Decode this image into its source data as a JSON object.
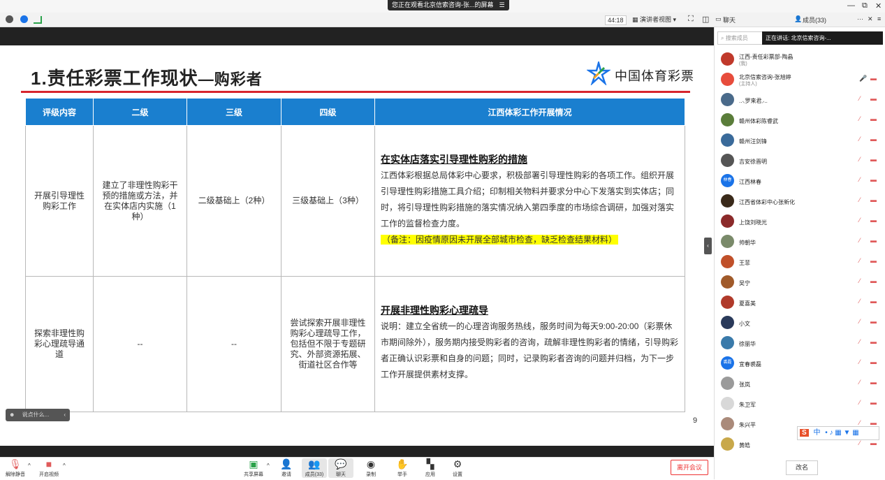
{
  "banner": {
    "text": "您正在观看北京信索咨询-张...的屏幕",
    "menu": "☰"
  },
  "window": {
    "minimize": "—",
    "restore": "⧉",
    "close": "✕"
  },
  "toolbar": {
    "timer": "44:18",
    "view_label": "演讲者视图"
  },
  "slide": {
    "title_main": "1.责任彩票工作现状",
    "title_sub": "—购彩者",
    "logo_text": "中国体育彩票",
    "headers": [
      "评级内容",
      "二级",
      "三级",
      "四级",
      "江西体彩工作开展情况"
    ],
    "rows": [
      {
        "c1": "开展引导理性购彩工作",
        "c2": "建立了非理性购彩干预的措施或方法，并在实体店内实施（1种）",
        "c3": "二级基础上（2种）",
        "c4": "三级基础上（3种）",
        "desc_title": "在实体店落实引导理性购彩的措施",
        "desc_body": "江西体彩根据总局体彩中心要求，积极部署引导理性购彩的各项工作。组织开展引导理性购彩措施工具介绍；印制相关物料并要求分中心下发落实到实体店；同时，将引导理性购彩措施的落实情况纳入第四季度的市场综合调研，加强对落实工作的监督检查力度。",
        "desc_note": "（备注：因疫情原因未开展全部城市检查，缺乏检查结果材料）"
      },
      {
        "c1": "探索非理性购彩心理疏导通道",
        "c2": "--",
        "c3": "--",
        "c4": "尝试探索开展非理性购彩心理疏导工作，包括但不限于专题研究、外部资源拓展、街道社区合作等",
        "desc_title": "开展非理性购彩心理疏导",
        "desc_body": "说明：建立全省统一的心理咨询服务热线，服务时间为每天9:00-20:00（彩票休市期间除外），服务期内接受购彩者的咨询，疏解非理性购彩者的情绪，引导购彩者正确认识彩票和自身的问题；同时，记录购彩者咨询的问题并归档，为下一步工作开展提供素材支撑。",
        "desc_note": ""
      }
    ],
    "page_number": "9"
  },
  "chat_input": {
    "placeholder": "说点什么..."
  },
  "bottom_bar": {
    "mute": "解除静音",
    "video": "开启视频",
    "share": "共享屏幕",
    "invite": "邀请",
    "members": "成员(33)",
    "chat": "聊天",
    "record": "录制",
    "raise_hand": "举手",
    "apps": "应用",
    "settings": "设置",
    "leave": "离开会议"
  },
  "panel": {
    "tab_chat": "聊天",
    "tab_members": "成员(33)",
    "search_placeholder": "搜索成员",
    "speaking": "正在讲话: 北京信索咨询-...",
    "rename": "改名",
    "members": [
      {
        "name": "江西-责任彩票部-陶晶",
        "role": "(我)",
        "color": "#c0392b"
      },
      {
        "name": "北京信索咨询-张旭婷",
        "role": "(主持人)",
        "color": "#e74c3c"
      },
      {
        "name": "..⸜罗来君⸝..",
        "role": "",
        "color": "#4a6a8a"
      },
      {
        "name": "赣州体彩陈睿武",
        "role": "",
        "color": "#5a7d3a"
      },
      {
        "name": "赣州汪剑锋",
        "role": "",
        "color": "#3a6a9a"
      },
      {
        "name": "吉安徐晋明",
        "role": "",
        "color": "#555555"
      },
      {
        "name": "江西林春",
        "role": "",
        "color": "#1a73e8"
      },
      {
        "name": "江西省体彩中心张新化",
        "role": "",
        "color": "#3a2a1a"
      },
      {
        "name": "上饶刘晓光",
        "role": "",
        "color": "#8b2a2a"
      },
      {
        "name": "帅朝华",
        "role": "",
        "color": "#7a8a6a"
      },
      {
        "name": "王菲",
        "role": "",
        "color": "#c0502a"
      },
      {
        "name": "吴宁",
        "role": "",
        "color": "#a05a2a"
      },
      {
        "name": "夏喜美",
        "role": "",
        "color": "#b03a2a"
      },
      {
        "name": "小文",
        "role": "",
        "color": "#2a3a5a"
      },
      {
        "name": "徐丽华",
        "role": "",
        "color": "#3a7aaa"
      },
      {
        "name": "宜春裘磊",
        "role": "",
        "color": "#1a73e8"
      },
      {
        "name": "张岚",
        "role": "",
        "color": "#9a9a9a"
      },
      {
        "name": "朱卫军",
        "role": "",
        "color": "#d8d8d8"
      },
      {
        "name": "朱兴平",
        "role": "",
        "color": "#aa8a7a"
      },
      {
        "name": "黄皓",
        "role": "",
        "color": "#c8a84a"
      }
    ]
  },
  "avatar_text": {
    "linchun": "林春",
    "qiulei": "裘磊"
  },
  "ime": {
    "label": "中"
  }
}
